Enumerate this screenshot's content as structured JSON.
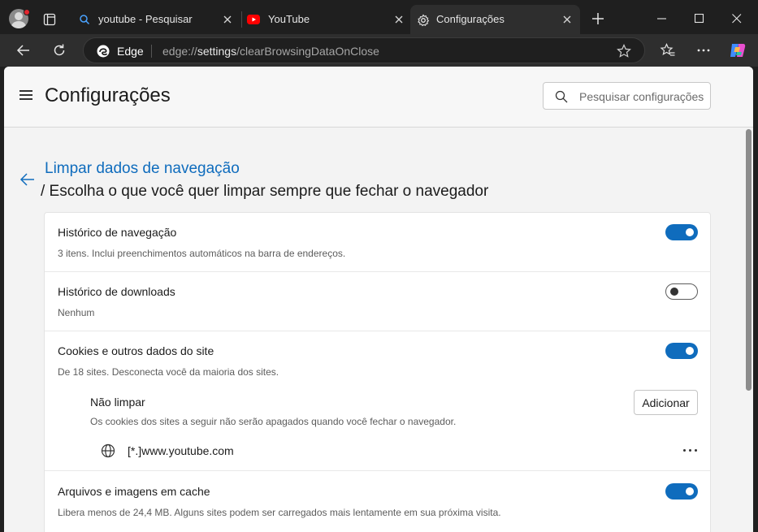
{
  "browser": {
    "tabs": [
      {
        "title": "youtube - Pesquisar",
        "icon": "search-icon",
        "active": false
      },
      {
        "title": "YouTube",
        "icon": "youtube-icon",
        "active": false
      },
      {
        "title": "Configurações",
        "icon": "gear-icon",
        "active": true
      }
    ],
    "address": {
      "brand": "Edge",
      "url_prefix": "edge://",
      "url_bold": "settings",
      "url_suffix": "/clearBrowsingDataOnClose"
    }
  },
  "settings": {
    "title": "Configurações",
    "search_placeholder": "Pesquisar configurações",
    "breadcrumb_link": "Limpar dados de navegação",
    "breadcrumb_rest": "/ Escolha o que você quer limpar sempre que fechar o navegador",
    "items": [
      {
        "title": "Histórico de navegação",
        "desc": "3 itens. Inclui preenchimentos automáticos na barra de endereços.",
        "enabled": true
      },
      {
        "title": "Histórico de downloads",
        "desc": "Nenhum",
        "enabled": false
      },
      {
        "title": "Cookies e outros dados do site",
        "desc": "De 18 sites. Desconecta você da maioria dos sites.",
        "enabled": true
      },
      {
        "title": "Arquivos e imagens em cache",
        "desc": "Libera menos de 24,4 MB. Alguns sites podem ser carregados mais lentamente em sua próxima visita.",
        "enabled": true
      }
    ],
    "exceptions": {
      "title": "Não limpar",
      "desc": "Os cookies dos sites a seguir não serão apagados quando você fechar o navegador.",
      "add_label": "Adicionar",
      "sites": [
        "[*.]www.youtube.com"
      ]
    }
  },
  "colors": {
    "accent": "#0f6cbd",
    "toggle_on": "#0f6cbd",
    "youtube_red": "#ff0000",
    "profile_badge": "#e3262f"
  }
}
